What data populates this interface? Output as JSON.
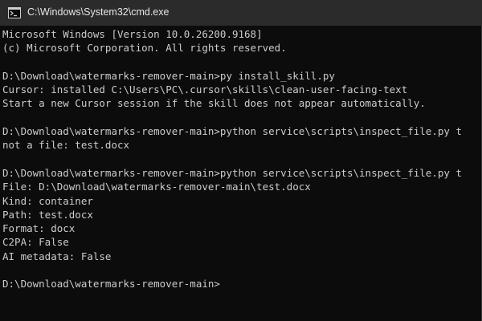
{
  "window": {
    "title": "C:\\Windows\\System32\\cmd.exe",
    "icon": "console-icon"
  },
  "console": {
    "lines": [
      "Microsoft Windows [Version 10.0.26200.9168]",
      "(c) Microsoft Corporation. All rights reserved.",
      "",
      "D:\\Download\\watermarks-remover-main>py install_skill.py",
      "Cursor: installed C:\\Users\\PC\\.cursor\\skills\\clean-user-facing-text",
      "Start a new Cursor session if the skill does not appear automatically.",
      "",
      "D:\\Download\\watermarks-remover-main>python service\\scripts\\inspect_file.py t",
      "not a file: test.docx",
      "",
      "D:\\Download\\watermarks-remover-main>python service\\scripts\\inspect_file.py t",
      "File: D:\\Download\\watermarks-remover-main\\test.docx",
      "Kind: container",
      "Path: test.docx",
      "Format: docx",
      "C2PA: False",
      "AI metadata: False",
      "",
      "D:\\Download\\watermarks-remover-main>"
    ]
  },
  "colors": {
    "background": "#0c0c0c",
    "text": "#cccccc",
    "titlebar": "#2b2b2b"
  }
}
